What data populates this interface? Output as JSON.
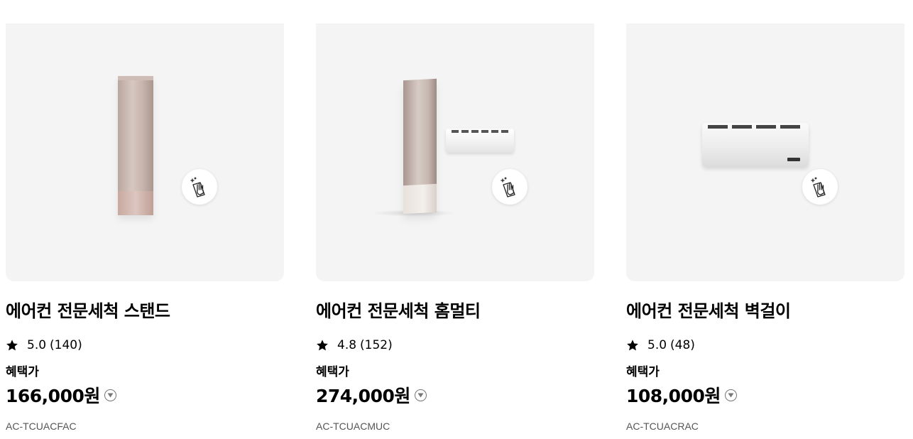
{
  "products": [
    {
      "title": "에어컨 전문세척 스탠드",
      "rating": "5.0",
      "reviews": "(140)",
      "benefit_label": "혜택가",
      "price": "166,000원",
      "model": "AC-TCUACFAC",
      "image": "standing-air-conditioner",
      "badge_icon": "cleaning-hand-icon"
    },
    {
      "title": "에어컨 전문세척 홈멀티",
      "rating": "4.8",
      "reviews": "(152)",
      "benefit_label": "혜택가",
      "price": "274,000원",
      "model": "AC-TCUACMUC",
      "image": "stand-and-wall-air-conditioner",
      "badge_icon": "cleaning-hand-icon"
    },
    {
      "title": "에어컨 전문세척 벽걸이",
      "rating": "5.0",
      "reviews": "(48)",
      "benefit_label": "혜택가",
      "price": "108,000원",
      "model": "AC-TCUACRAC",
      "image": "wall-mounted-air-conditioner",
      "badge_icon": "cleaning-hand-icon"
    }
  ],
  "colors": {
    "thumb_bg": "#f4f4f4",
    "text": "#000000",
    "muted": "#555555"
  }
}
